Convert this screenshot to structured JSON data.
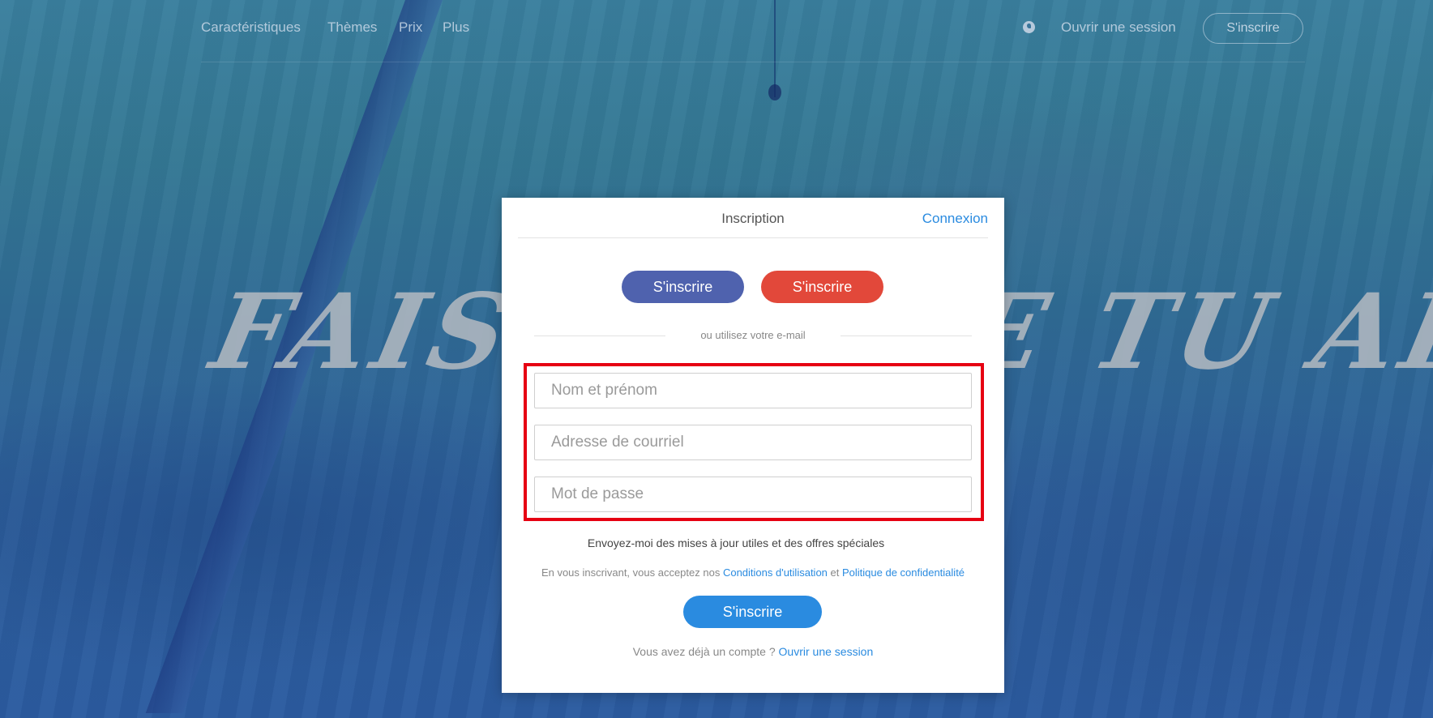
{
  "nav": {
    "items": [
      "Caractéristiques",
      "Thèmes",
      "Prix",
      "Plus"
    ],
    "login": "Ouvrir une session",
    "signup": "S'inscrire",
    "globe_icon": "globe-icon"
  },
  "hero": {
    "text": "FAIS CE QUE TU AIMES"
  },
  "modal": {
    "tab_active": "Inscription",
    "tab_login": "Connexion",
    "facebook_button": "S'inscrire",
    "google_button": "S'inscrire",
    "or_text": "ou utilisez votre e-mail",
    "fields": {
      "name_placeholder": "Nom et prénom",
      "email_placeholder": "Adresse de courriel",
      "password_placeholder": "Mot de passe"
    },
    "newsletter": "Envoyez-moi des mises à jour utiles et des offres spéciales",
    "terms_prefix": "En vous inscrivant, vous acceptez nos ",
    "terms_link": "Conditions d'utilisation",
    "terms_and": " et ",
    "privacy_link": "Politique de confidentialité",
    "submit": "S'inscrire",
    "have_account": "Vous avez déjà un compte ? ",
    "login_link": "Ouvrir une session"
  },
  "colors": {
    "accent": "#2a8be0",
    "facebook": "#4f62ae",
    "google": "#e2483a",
    "highlight": "#e60012"
  }
}
